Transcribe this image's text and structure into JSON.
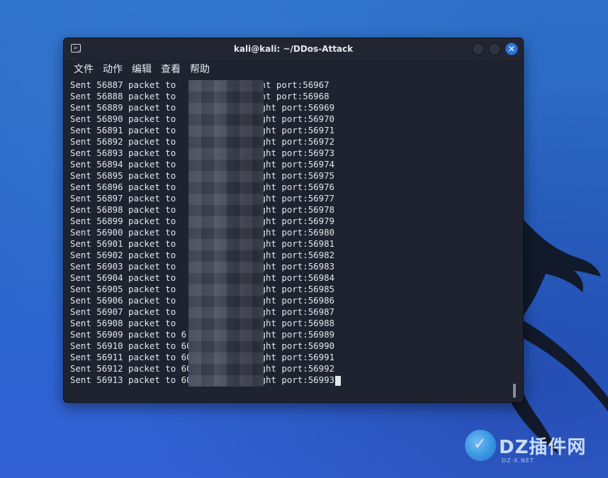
{
  "window": {
    "title": "kali@kali: ~/DDos-Attack",
    "icon": "terminal-icon",
    "buttons": {
      "minimize": "minimize-icon",
      "maximize": "maximize-icon",
      "close": "✕"
    }
  },
  "menu": [
    "文件",
    "动作",
    "编辑",
    "查看",
    "帮助"
  ],
  "terminal": {
    "lines": [
      {
        "prefix": "Sent 56887 packet to ",
        "tail": "         throught port:56967"
      },
      {
        "prefix": "Sent 56888 packet to ",
        "tail": "         throught port:56968"
      },
      {
        "prefix": "Sent 56889 packet to ",
        "tail": "        1 throught port:56969"
      },
      {
        "prefix": "Sent 56890 packet to ",
        "tail": "        1 throught port:56970"
      },
      {
        "prefix": "Sent 56891 packet to ",
        "tail": "        1 throught port:56971"
      },
      {
        "prefix": "Sent 56892 packet to ",
        "tail": "        1 throught port:56972"
      },
      {
        "prefix": "Sent 56893 packet to ",
        "tail": "        1 throught port:56973"
      },
      {
        "prefix": "Sent 56894 packet to ",
        "tail": "        1 throught port:56974"
      },
      {
        "prefix": "Sent 56895 packet to ",
        "tail": "        1 throught port:56975"
      },
      {
        "prefix": "Sent 56896 packet to ",
        "tail": "        1 throught port:56976"
      },
      {
        "prefix": "Sent 56897 packet to ",
        "tail": "        1 throught port:56977"
      },
      {
        "prefix": "Sent 56898 packet to ",
        "tail": "        1 throught port:56978"
      },
      {
        "prefix": "Sent 56899 packet to ",
        "tail": "       21 throught port:56979"
      },
      {
        "prefix": "Sent 56900 packet to ",
        "tail": "       21 throught port:56980"
      },
      {
        "prefix": "Sent 56901 packet to ",
        "tail": "       21 throught port:56981"
      },
      {
        "prefix": "Sent 56902 packet to ",
        "tail": "      .21 throught port:56982"
      },
      {
        "prefix": "Sent 56903 packet to ",
        "tail": "      .21 throught port:56983"
      },
      {
        "prefix": "Sent 56904 packet to ",
        "tail": "      .21 throught port:56984"
      },
      {
        "prefix": "Sent 56905 packet to ",
        "tail": "      .21 throught port:56985"
      },
      {
        "prefix": "Sent 56906 packet to ",
        "tail": "      .21 throught port:56986"
      },
      {
        "prefix": "Sent 56907 packet to ",
        "tail": "      .21 throught port:56987"
      },
      {
        "prefix": "Sent 56908 packet to ",
        "tail": "      .21 throught port:56988"
      },
      {
        "prefix": "Sent 56909 packet to ",
        "tail": "6     .21 throught port:56989"
      },
      {
        "prefix": "Sent 56910 packet to ",
        "tail": "60    .21 throught port:56990"
      },
      {
        "prefix": "Sent 56911 packet to ",
        "tail": "60   3.21 throught port:56991"
      },
      {
        "prefix": "Sent 56912 packet to ",
        "tail": "60   3.21 throught port:56992"
      },
      {
        "prefix": "Sent 56913 packet to ",
        "tail": "60   3.21 throught port:56993"
      }
    ]
  },
  "watermark": {
    "text": "DZ插件网",
    "sub": "DZ-X.NET"
  }
}
